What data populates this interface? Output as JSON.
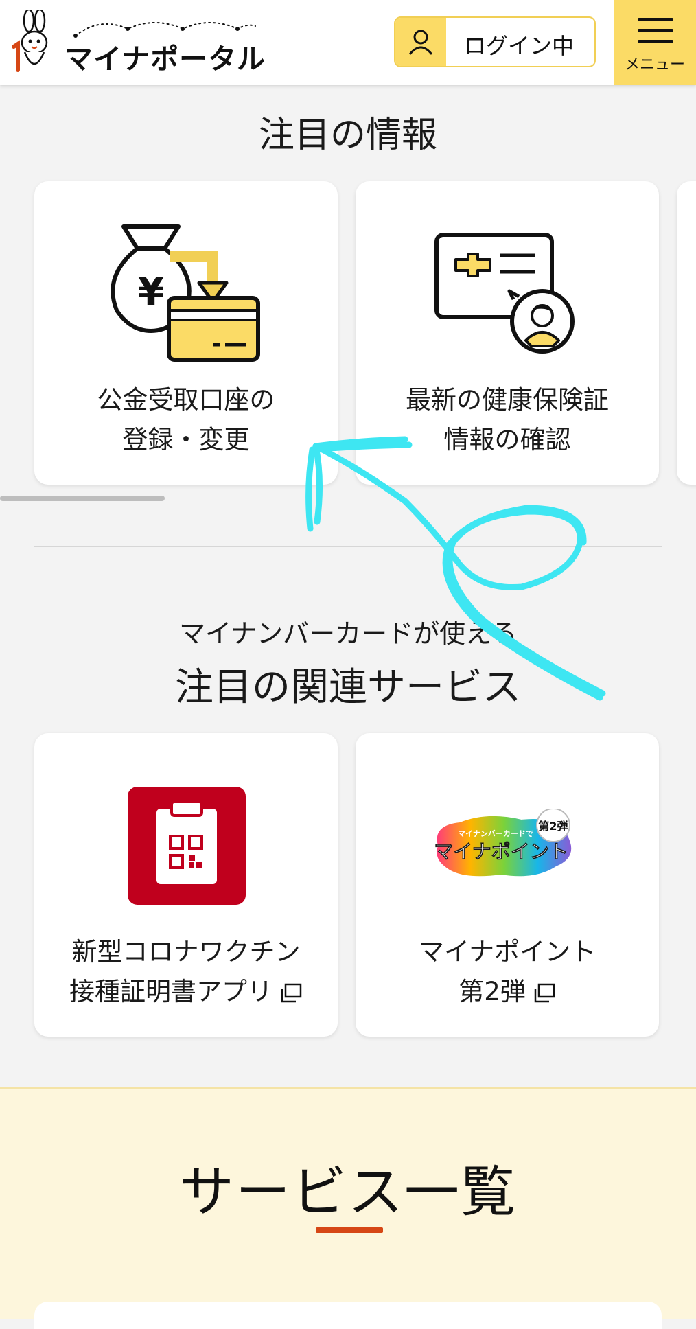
{
  "header": {
    "logo_text": "マイナポータル",
    "login_label": "ログイン中",
    "menu_label": "メニュー"
  },
  "featured": {
    "title": "注目の情報",
    "cards": [
      {
        "icon": "money-bag-to-card-icon",
        "line1": "公金受取口座の",
        "line2": "登録・変更"
      },
      {
        "icon": "health-insurance-card-icon",
        "line1": "最新の健康保険証",
        "line2": "情報の確認"
      }
    ]
  },
  "related": {
    "subtitle": "マイナンバーカードが使える",
    "title": "注目の関連サービス",
    "cards": [
      {
        "icon": "vaccine-certificate-app-icon",
        "line1": "新型コロナワクチン",
        "line2": "接種証明書アプリ",
        "external": true
      },
      {
        "icon": "mynapoint-logo",
        "line1": "マイナポイント",
        "line2": "第2弾",
        "external": true,
        "logo_top": "マイナンバーカードで",
        "logo_main": "マイナポイント",
        "logo_badge": "第2弾"
      }
    ]
  },
  "services": {
    "title": "サービス一覧"
  },
  "colors": {
    "brand_yellow": "#fbdb66",
    "accent_red": "#d64715",
    "vaccine_red": "#c0001d",
    "annotation_cyan": "#3ee6f2"
  }
}
